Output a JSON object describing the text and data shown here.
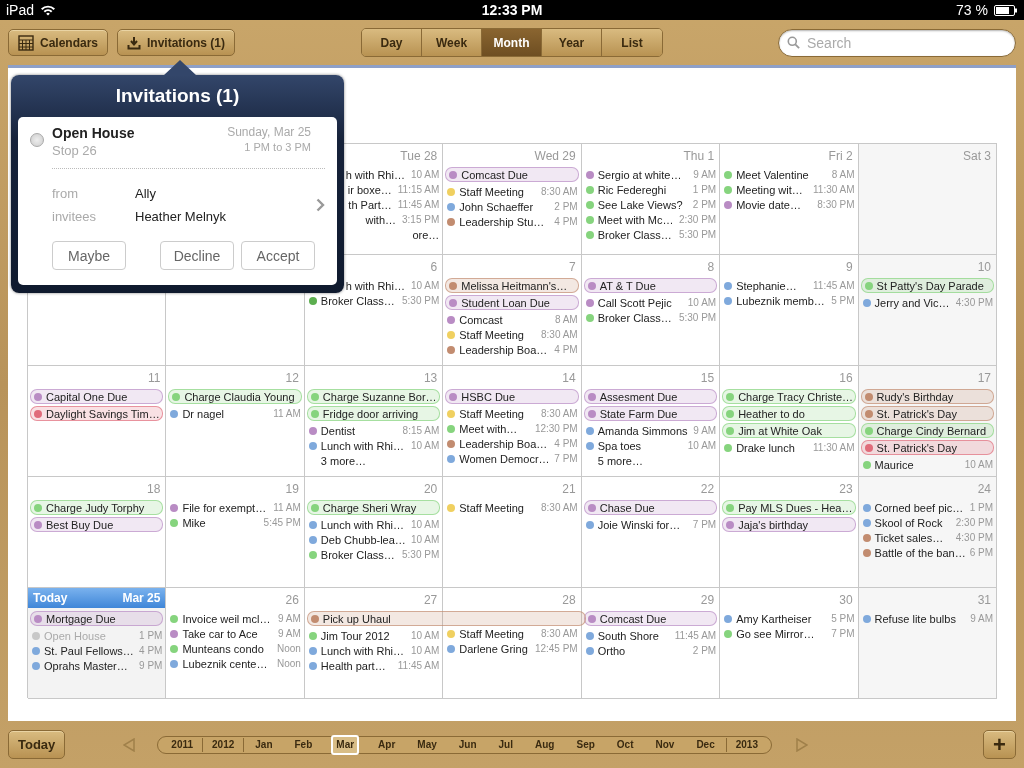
{
  "status_bar": {
    "device": "iPad",
    "time": "12:33 PM",
    "battery": "73 %"
  },
  "toolbar": {
    "calendars_button": "Calendars",
    "invitations_button": "Invitations (1)",
    "view_tabs": [
      {
        "label": "Day",
        "selected": false
      },
      {
        "label": "Week",
        "selected": false
      },
      {
        "label": "Month",
        "selected": true
      },
      {
        "label": "Year",
        "selected": false
      },
      {
        "label": "List",
        "selected": false
      }
    ],
    "search": {
      "placeholder": "Search"
    }
  },
  "calendar": {
    "weeks": [
      {
        "days": [
          {
            "kind": "hidden"
          },
          {
            "kind": "hidden"
          },
          {
            "kind": "day",
            "label": "Tue 28",
            "events": [
              {
                "kind": "fragment",
                "title": "h with Rhi…",
                "time": "10 AM"
              },
              {
                "kind": "fragment",
                "title": "ir boxe…",
                "time": "11:15 AM"
              },
              {
                "kind": "fragment",
                "title": "th Part…",
                "time": "11:45 AM"
              },
              {
                "kind": "fragment",
                "title": "with…",
                "time": "3:15 PM"
              },
              {
                "kind": "fragment",
                "title": "ore…"
              }
            ]
          },
          {
            "kind": "day",
            "label": "Wed 29",
            "events": [
              {
                "kind": "allday",
                "title": "Comcast Due",
                "color": "#b98cc4"
              },
              {
                "kind": "timed",
                "title": "Staff Meeting",
                "time": "8:30 AM",
                "color": "#f0d060"
              },
              {
                "kind": "timed",
                "title": "John Schaeffer",
                "time": "2 PM",
                "color": "#7fa9dc"
              },
              {
                "kind": "timed",
                "title": "Leadership Stu…",
                "time": "4 PM",
                "color": "#c28c70"
              }
            ]
          },
          {
            "kind": "day",
            "label": "Thu 1",
            "events": [
              {
                "kind": "timed",
                "title": "Sergio at white…",
                "time": "9 AM",
                "color": "#b98cc4"
              },
              {
                "kind": "timed",
                "title": "Ric Federeghi",
                "time": "1 PM",
                "color": "#86d47e"
              },
              {
                "kind": "timed",
                "title": "See Lake Views?",
                "time": "2 PM",
                "color": "#86d47e"
              },
              {
                "kind": "timed",
                "title": "Meet with Mc…",
                "time": "2:30 PM",
                "color": "#86d47e"
              },
              {
                "kind": "timed",
                "title": "Broker Class…",
                "time": "5:30 PM",
                "color": "#86d47e"
              }
            ]
          },
          {
            "kind": "day",
            "label": "Fri 2",
            "events": [
              {
                "kind": "timed",
                "title": "Meet Valentine",
                "time": "8 AM",
                "color": "#86d47e"
              },
              {
                "kind": "timed",
                "title": "Meeting wit…",
                "time": "11:30 AM",
                "color": "#86d47e"
              },
              {
                "kind": "timed",
                "title": "Movie date…",
                "time": "8:30 PM",
                "color": "#b98cc4"
              }
            ]
          },
          {
            "kind": "weekend",
            "label": "Sat 3"
          }
        ]
      },
      {
        "days": [
          {
            "kind": "hidden"
          },
          {
            "kind": "hidden"
          },
          {
            "kind": "day",
            "label": "6",
            "events": [
              {
                "kind": "fragment",
                "title": "h with Rhi…",
                "time": "10 AM"
              },
              {
                "kind": "timed",
                "title": "Broker Class…",
                "time": "5:30 PM",
                "color": "#5cae4f"
              }
            ]
          },
          {
            "kind": "day",
            "label": "7",
            "events": [
              {
                "kind": "allday",
                "title": "Melissa Heitmann's…",
                "color": "#c28c70"
              },
              {
                "kind": "allday",
                "title": "Student Loan Due",
                "color": "#b98cc4"
              },
              {
                "kind": "timed",
                "title": "Comcast",
                "time": "8 AM",
                "color": "#b98cc4"
              },
              {
                "kind": "timed",
                "title": "Staff Meeting",
                "time": "8:30 AM",
                "color": "#f0d060"
              },
              {
                "kind": "timed",
                "title": "Leadership Boa…",
                "time": "4 PM",
                "color": "#c28c70"
              }
            ]
          },
          {
            "kind": "day",
            "label": "8",
            "events": [
              {
                "kind": "allday",
                "title": "AT & T Due",
                "color": "#b98cc4"
              },
              {
                "kind": "timed",
                "title": "Call Scott Pejic",
                "time": "10 AM",
                "color": "#b98cc4"
              },
              {
                "kind": "timed",
                "title": "Broker Class…",
                "time": "5:30 PM",
                "color": "#86d47e"
              }
            ]
          },
          {
            "kind": "day",
            "label": "9",
            "events": [
              {
                "kind": "timed",
                "title": "Stephanie…",
                "time": "11:45 AM",
                "color": "#7fa9dc"
              },
              {
                "kind": "timed",
                "title": "Lubeznik memb…",
                "time": "5 PM",
                "color": "#7fa9dc"
              }
            ]
          },
          {
            "kind": "weekend",
            "label": "10",
            "events": [
              {
                "kind": "allday",
                "title": "St Patty's Day Parade",
                "color": "#86d47e"
              },
              {
                "kind": "timed",
                "title": "Jerry and Vic…",
                "time": "4:30 PM",
                "color": "#7fa9dc"
              }
            ]
          }
        ]
      },
      {
        "days": [
          {
            "kind": "day",
            "label": "11",
            "events": [
              {
                "kind": "allday",
                "title": "Capital One Due",
                "color": "#b98cc4"
              },
              {
                "kind": "allday",
                "title": "Daylight Savings Tim…",
                "color": "#e06b7a"
              }
            ]
          },
          {
            "kind": "day",
            "label": "12",
            "events": [
              {
                "kind": "allday",
                "title": "Charge Claudia Young",
                "color": "#86d47e"
              },
              {
                "kind": "timed",
                "title": "Dr nagel",
                "time": "11 AM",
                "color": "#7fa9dc"
              }
            ]
          },
          {
            "kind": "day",
            "label": "13",
            "events": [
              {
                "kind": "allday",
                "title": "Charge Suzanne Bor…",
                "color": "#86d47e"
              },
              {
                "kind": "allday",
                "title": "Fridge door arriving",
                "color": "#86d47e"
              },
              {
                "kind": "timed",
                "title": "Dentist",
                "time": "8:15 AM",
                "color": "#b98cc4"
              },
              {
                "kind": "timed",
                "title": "Lunch with Rhi…",
                "time": "10 AM",
                "color": "#7fa9dc"
              },
              {
                "kind": "more",
                "title": "3 more…"
              }
            ]
          },
          {
            "kind": "day",
            "label": "14",
            "events": [
              {
                "kind": "allday",
                "title": "HSBC Due",
                "color": "#b98cc4"
              },
              {
                "kind": "timed",
                "title": "Staff Meeting",
                "time": "8:30 AM",
                "color": "#f0d060"
              },
              {
                "kind": "timed",
                "title": "Meet with…",
                "time": "12:30 PM",
                "color": "#86d47e"
              },
              {
                "kind": "timed",
                "title": "Leadership Boa…",
                "time": "4 PM",
                "color": "#c28c70"
              },
              {
                "kind": "timed",
                "title": "Women Democr…",
                "time": "7 PM",
                "color": "#7fa9dc"
              }
            ]
          },
          {
            "kind": "day",
            "label": "15",
            "events": [
              {
                "kind": "allday",
                "title": "Assesment Due",
                "color": "#b98cc4"
              },
              {
                "kind": "allday",
                "title": "State Farm Due",
                "color": "#b98cc4"
              },
              {
                "kind": "timed",
                "title": "Amanda Simmons",
                "time": "9 AM",
                "color": "#7fa9dc"
              },
              {
                "kind": "timed",
                "title": "Spa toes",
                "time": "10 AM",
                "color": "#7fa9dc"
              },
              {
                "kind": "more",
                "title": "5 more…"
              }
            ]
          },
          {
            "kind": "day",
            "label": "16",
            "events": [
              {
                "kind": "allday",
                "title": "Charge Tracy Christe…",
                "color": "#86d47e"
              },
              {
                "kind": "allday",
                "title": "Heather to do",
                "color": "#86d47e"
              },
              {
                "kind": "allday",
                "title": "Jim at White Oak",
                "color": "#86d47e"
              },
              {
                "kind": "timed",
                "title": "Drake lunch",
                "time": "11:30 AM",
                "color": "#86d47e"
              }
            ]
          },
          {
            "kind": "weekend",
            "label": "17",
            "events": [
              {
                "kind": "allday",
                "title": "Rudy's Birthday",
                "color": "#c28c70"
              },
              {
                "kind": "allday",
                "title": "St. Patrick's Day",
                "color": "#c28c70"
              },
              {
                "kind": "allday",
                "title": "Charge Cindy Bernard",
                "color": "#86d47e"
              },
              {
                "kind": "allday",
                "title": "St. Patrick's Day",
                "color": "#e06b7a"
              },
              {
                "kind": "timed",
                "title": "Maurice",
                "time": "10 AM",
                "color": "#86d47e"
              }
            ]
          }
        ]
      },
      {
        "days": [
          {
            "kind": "day",
            "label": "18",
            "events": [
              {
                "kind": "allday",
                "title": "Charge Judy Torphy",
                "color": "#86d47e"
              },
              {
                "kind": "allday",
                "title": "Best Buy Due",
                "color": "#b98cc4"
              }
            ]
          },
          {
            "kind": "day",
            "label": "19",
            "events": [
              {
                "kind": "timed",
                "title": "File for exempt…",
                "time": "11 AM",
                "color": "#b98cc4"
              },
              {
                "kind": "timed",
                "title": "Mike",
                "time": "5:45 PM",
                "color": "#86d47e"
              }
            ]
          },
          {
            "kind": "day",
            "label": "20",
            "events": [
              {
                "kind": "allday",
                "title": "Charge Sheri Wray",
                "color": "#86d47e"
              },
              {
                "kind": "timed",
                "title": "Lunch with Rhi…",
                "time": "10 AM",
                "color": "#7fa9dc"
              },
              {
                "kind": "timed",
                "title": "Deb Chubb-lea…",
                "time": "10 AM",
                "color": "#7fa9dc"
              },
              {
                "kind": "timed",
                "title": "Broker Class…",
                "time": "5:30 PM",
                "color": "#86d47e"
              }
            ]
          },
          {
            "kind": "day",
            "label": "21",
            "events": [
              {
                "kind": "timed",
                "title": "Staff Meeting",
                "time": "8:30 AM",
                "color": "#f0d060"
              }
            ]
          },
          {
            "kind": "day",
            "label": "22",
            "events": [
              {
                "kind": "allday",
                "title": "Chase Due",
                "color": "#b98cc4"
              },
              {
                "kind": "timed",
                "title": "Joie Winski for…",
                "time": "7 PM",
                "color": "#7fa9dc"
              }
            ]
          },
          {
            "kind": "day",
            "label": "23",
            "events": [
              {
                "kind": "allday",
                "title": "Pay MLS Dues - Hea…",
                "color": "#86d47e"
              },
              {
                "kind": "allday",
                "title": "Jaja's birthday",
                "color": "#b98cc4"
              }
            ]
          },
          {
            "kind": "weekend",
            "label": "24",
            "events": [
              {
                "kind": "timed",
                "title": "Corned beef pic…",
                "time": "1 PM",
                "color": "#7fa9dc"
              },
              {
                "kind": "timed",
                "title": "Skool of Rock",
                "time": "2:30 PM",
                "color": "#7fa9dc"
              },
              {
                "kind": "timed",
                "title": "Ticket sales…",
                "time": "4:30 PM",
                "color": "#c28c70"
              },
              {
                "kind": "timed",
                "title": "Battle of the ban…",
                "time": "6 PM",
                "color": "#c28c70"
              }
            ]
          }
        ]
      },
      {
        "days": [
          {
            "kind": "today",
            "label": "Today",
            "date": "Mar 25",
            "events": [
              {
                "kind": "allday",
                "title": "Mortgage Due",
                "color": "#b98cc4"
              },
              {
                "kind": "pending",
                "title": "Open House",
                "time": "1 PM",
                "color": "#c8c8c8"
              },
              {
                "kind": "timed",
                "title": "St. Paul Fellows…",
                "time": "4 PM",
                "color": "#7fa9dc"
              },
              {
                "kind": "timed",
                "title": "Oprahs Master…",
                "time": "9 PM",
                "color": "#7fa9dc"
              }
            ]
          },
          {
            "kind": "day",
            "label": "26",
            "events": [
              {
                "kind": "timed",
                "title": "Invoice weil mcl…",
                "time": "9 AM",
                "color": "#86d47e"
              },
              {
                "kind": "timed",
                "title": "Take car to Ace",
                "time": "9 AM",
                "color": "#b98cc4"
              },
              {
                "kind": "timed",
                "title": "Munteans condo",
                "time": "Noon",
                "color": "#86d47e"
              },
              {
                "kind": "timed",
                "title": "Lubeznik cente…",
                "time": "Noon",
                "color": "#7fa9dc"
              }
            ]
          },
          {
            "kind": "day",
            "label": "27",
            "events": [
              {
                "kind": "span",
                "title": "Pick up Uhaul",
                "color": "#c28c70"
              },
              {
                "kind": "timed",
                "title": "Jim Tour 2012",
                "time": "10 AM",
                "color": "#86d47e"
              },
              {
                "kind": "timed",
                "title": "Lunch with Rhi…",
                "time": "10 AM",
                "color": "#7fa9dc"
              },
              {
                "kind": "timed",
                "title": "Health part…",
                "time": "11:45 AM",
                "color": "#7fa9dc"
              }
            ]
          },
          {
            "kind": "day",
            "label": "28",
            "events": [
              {
                "kind": "timed",
                "title": "Staff Meeting",
                "time": "8:30 AM",
                "color": "#f0d060"
              },
              {
                "kind": "timed",
                "title": "Darlene Gring",
                "time": "12:45 PM",
                "color": "#7fa9dc"
              }
            ]
          },
          {
            "kind": "day",
            "label": "29",
            "events": [
              {
                "kind": "allday",
                "title": "Comcast Due",
                "color": "#b98cc4"
              },
              {
                "kind": "timed",
                "title": "South Shore",
                "time": "11:45 AM",
                "color": "#7fa9dc"
              },
              {
                "kind": "timed",
                "title": "Ortho",
                "time": "2 PM",
                "color": "#7fa9dc"
              }
            ]
          },
          {
            "kind": "day",
            "label": "30",
            "events": [
              {
                "kind": "timed",
                "title": "Amy Kartheiser",
                "time": "5 PM",
                "color": "#7fa9dc"
              },
              {
                "kind": "timed",
                "title": "Go see Mirror…",
                "time": "7 PM",
                "color": "#86d47e"
              }
            ]
          },
          {
            "kind": "weekend",
            "label": "31",
            "events": [
              {
                "kind": "timed",
                "title": "Refuse lite bulbs",
                "time": "9 AM",
                "color": "#7fa9dc"
              }
            ]
          }
        ]
      }
    ]
  },
  "popover": {
    "title": "Invitations (1)",
    "invitation": {
      "title": "Open House",
      "location": "Stop 26",
      "date": "Sunday, Mar 25",
      "time": "1 PM to 3 PM",
      "fields": [
        {
          "label": "from",
          "value": "Ally"
        },
        {
          "label": "invitees",
          "value": "Heather Melnyk"
        }
      ]
    },
    "buttons": [
      "Maybe",
      "Decline",
      "Accept"
    ]
  },
  "bottom_bar": {
    "today_button": "Today",
    "add_button": "+",
    "timeline": [
      {
        "kind": "year",
        "label": "2011",
        "selected": false
      },
      {
        "kind": "year",
        "label": "2012",
        "selected": false
      },
      {
        "kind": "month",
        "label": "Jan",
        "selected": false
      },
      {
        "kind": "month",
        "label": "Feb",
        "selected": false
      },
      {
        "kind": "month",
        "label": "Mar",
        "selected": true
      },
      {
        "kind": "month",
        "label": "Apr",
        "selected": false
      },
      {
        "kind": "month",
        "label": "May",
        "selected": false
      },
      {
        "kind": "month",
        "label": "Jun",
        "selected": false
      },
      {
        "kind": "month",
        "label": "Jul",
        "selected": false
      },
      {
        "kind": "month",
        "label": "Aug",
        "selected": false
      },
      {
        "kind": "month",
        "label": "Sep",
        "selected": false
      },
      {
        "kind": "month",
        "label": "Oct",
        "selected": false
      },
      {
        "kind": "month",
        "label": "Nov",
        "selected": false
      },
      {
        "kind": "month",
        "label": "Dec",
        "selected": false
      },
      {
        "kind": "year",
        "label": "2013",
        "selected": false
      }
    ]
  }
}
